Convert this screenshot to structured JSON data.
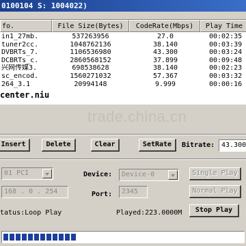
{
  "window": {
    "title": "0100104 S: 1004022)"
  },
  "table": {
    "columns": [
      {
        "label": "fo.",
        "key": "info"
      },
      {
        "label": "File Size(Bytes)",
        "key": "size"
      },
      {
        "label": "CodeRate(Mbps)",
        "key": "rate"
      },
      {
        "label": "Play Time",
        "key": "time"
      }
    ],
    "rows": [
      {
        "info": "in1_27mb.",
        "size": "537263956",
        "rate": "27.0",
        "time": "00:02:35"
      },
      {
        "info": "tuner2cc.",
        "size": "1048762136",
        "rate": "38.140",
        "time": "00:03:39"
      },
      {
        "info": "DVBRTs_7.",
        "size": "1106536980",
        "rate": "43.300",
        "time": "00:03:24"
      },
      {
        "info": "DCBRTs_c.",
        "size": "2860568152",
        "rate": "37.899",
        "time": "00:09:48"
      },
      {
        "info": "兴网传媒3.",
        "size": "698538628",
        "rate": "38.140",
        "time": "00:02:23"
      },
      {
        "info": "sc_encod.",
        "size": "1560271032",
        "rate": "57.367",
        "time": "00:03:32"
      },
      {
        "info": "264_3.1",
        "size": "20994148",
        "rate": "9.999",
        "time": "00:00:16"
      }
    ],
    "overlay": "center.niu"
  },
  "watermark": "trade.china.cn",
  "toolbar": {
    "insert": "Insert",
    "delete": "Delete",
    "clear": "Clear",
    "setrate": "SetRate",
    "bitrate_label": "Bitrate:",
    "bitrate_value": "43.300"
  },
  "device": {
    "pci_value": "01 PCI",
    "device_label": "Device:",
    "device_value": "Device-0",
    "single_play": "Single Play",
    "ip_value": "168 . 0 . 254",
    "port_label": "Port:",
    "port_value": "2345",
    "normal_play": "Normal Play"
  },
  "status": {
    "status_text": "tatus:Loop Play",
    "played_text": "Played:223.0000M",
    "stop_play": "Stop Play"
  },
  "progress": {
    "segments": 12
  }
}
